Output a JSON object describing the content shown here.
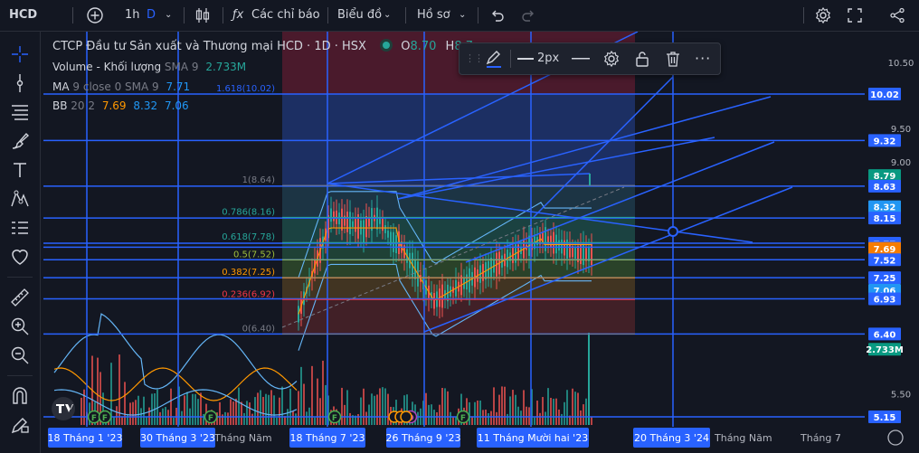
{
  "topbar": {
    "symbol": "HCD",
    "interval": "1h",
    "interval_style": "D",
    "indicators_label": "Các chỉ báo",
    "chart_type_label": "Biểu đồ",
    "profile_label": "Hồ sơ"
  },
  "legend": {
    "title": "CTCP Đầu tư Sản xuất và Thương mại HCD · 1D · HSX",
    "ohlc_o_label": "O",
    "ohlc_o_value": "8.70",
    "ohlc_h_label": "H",
    "ohlc_h_value": "8.7",
    "volume_label": "Volume - Khối lượng",
    "volume_params": "SMA 9",
    "volume_value": "2.733M",
    "ma_label": "MA",
    "ma_params": "9 close 0 SMA 9",
    "ma_value": "7.71",
    "bb_label": "BB",
    "bb_params": "20 2",
    "bb_v1": "7.69",
    "bb_v2": "8.32",
    "bb_v3": "7.06"
  },
  "drawing_toolbar": {
    "width_label": "2px"
  },
  "fib_levels": [
    {
      "label": "1.618(10.02)",
      "price": 10.02,
      "color": "#2962ff"
    },
    {
      "label": "1(8.64)",
      "price": 8.64,
      "color": "#787b86"
    },
    {
      "label": "0.786(8.16)",
      "price": 8.16,
      "color": "#26a69a"
    },
    {
      "label": "0.618(7.78)",
      "price": 7.78,
      "color": "#26a69a"
    },
    {
      "label": "0.5(7.52)",
      "price": 7.52,
      "color": "#9fbf3a"
    },
    {
      "label": "0.382(7.25)",
      "price": 7.25,
      "color": "#ff9800"
    },
    {
      "label": "0.236(6.92)",
      "price": 6.92,
      "color": "#f23645"
    },
    {
      "label": "0(6.40)",
      "price": 6.4,
      "color": "#787b86"
    }
  ],
  "price_axis": {
    "ticks": [
      "10.50",
      "9.50",
      "9.00",
      "5.50"
    ],
    "tags": [
      {
        "text": "10.02",
        "price": 10.02,
        "bg": "#2962ff"
      },
      {
        "text": "9.32",
        "price": 9.32,
        "bg": "#2962ff"
      },
      {
        "text": "8.79",
        "price": 8.79,
        "bg": "#089981"
      },
      {
        "text": "8.63",
        "price": 8.63,
        "bg": "#2962ff"
      },
      {
        "text": "8.32",
        "price": 8.32,
        "bg": "#2196f3"
      },
      {
        "text": "8.15",
        "price": 8.15,
        "bg": "#2962ff"
      },
      {
        "text": "7.77",
        "price": 7.77,
        "bg": "#2962ff"
      },
      {
        "text": "7.71",
        "price": 7.71,
        "bg": "#2962ff"
      },
      {
        "text": "7.69",
        "price": 7.69,
        "bg": "#f57c00"
      },
      {
        "text": "7.52",
        "price": 7.52,
        "bg": "#2962ff"
      },
      {
        "text": "7.25",
        "price": 7.25,
        "bg": "#2962ff"
      },
      {
        "text": "7.06",
        "price": 7.06,
        "bg": "#2196f3"
      },
      {
        "text": "6.93",
        "price": 6.93,
        "bg": "#2962ff"
      },
      {
        "text": "6.40",
        "price": 6.4,
        "bg": "#2962ff"
      },
      {
        "text": "2.733M",
        "price": 6.17,
        "bg": "#089981"
      },
      {
        "text": "5.15",
        "price": 5.15,
        "bg": "#2962ff"
      }
    ]
  },
  "time_axis": {
    "labels": [
      {
        "text": "18 Tháng 1 '23",
        "highlight": true
      },
      {
        "text": "30 Tháng 3 '23",
        "highlight": true
      },
      {
        "text": "Tháng Năm",
        "highlight": false
      },
      {
        "text": "18 Tháng 7 '23",
        "highlight": true
      },
      {
        "text": "26 Tháng 9 '23",
        "highlight": true
      },
      {
        "text": "11 Tháng Mười hai '23",
        "highlight": true
      },
      {
        "text": "20 Tháng 3 '24",
        "highlight": true
      },
      {
        "text": "Tháng Năm",
        "highlight": false
      },
      {
        "text": "Tháng 7",
        "highlight": false
      }
    ]
  },
  "event_markers": [
    "F",
    "F",
    "F",
    "F",
    "F",
    "D"
  ],
  "colors": {
    "background": "#131722",
    "drawing_blue": "#2962ff",
    "candle_up": "#26a69a",
    "candle_down": "#ef5350",
    "fib_top_zone": "#4a1a2c",
    "fib_blue_zone": "#1c2f63"
  },
  "icons": {
    "add": "plus-circle-icon",
    "indicators": "fx-icon",
    "compare": "candle-bars-icon",
    "undo": "undo-icon",
    "redo": "redo-icon",
    "settings": "gear-icon",
    "fullscreen": "fullscreen-icon",
    "share": "share-icon"
  }
}
